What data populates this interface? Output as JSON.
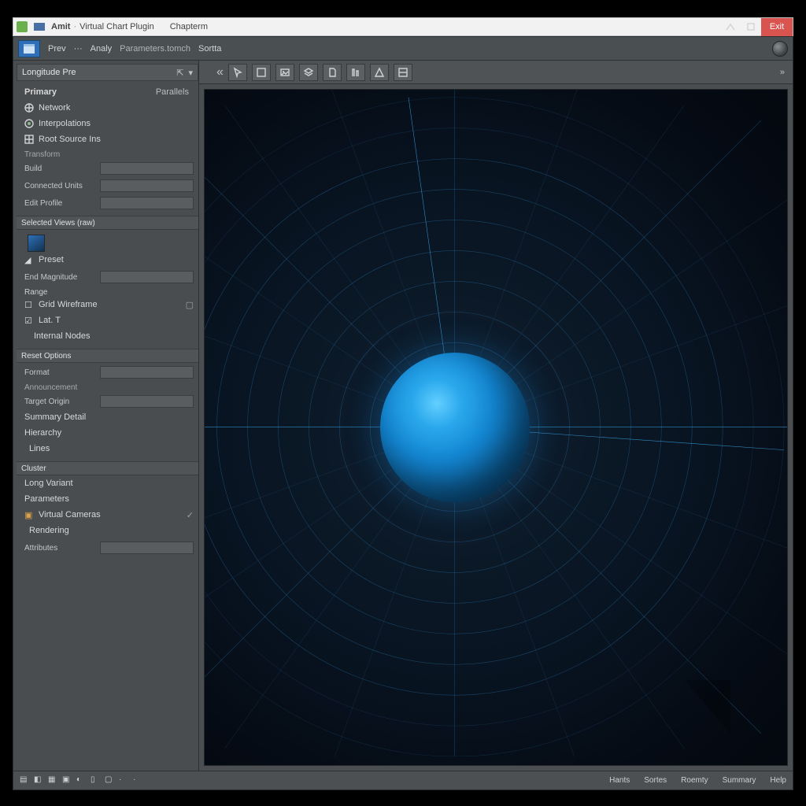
{
  "window": {
    "app_name": "Amit",
    "title_secondary": "Virtual Chart Plugin",
    "title_tertiary": "Chapterm",
    "close_label": "Exit"
  },
  "menubar": {
    "items": [
      "Prev",
      "Analy",
      "Parameters.tomch",
      "Sortta"
    ]
  },
  "sidebar": {
    "panel_title": "Longitude Pre",
    "top_tab_left": "Primary",
    "top_tab_right": "Parallels",
    "nav": [
      {
        "label": "Network",
        "icon": "globe"
      },
      {
        "label": "Interpolations",
        "icon": "target"
      },
      {
        "label": "Root Source Ins",
        "icon": "grid"
      }
    ],
    "group_transform": {
      "header": "Transform",
      "fields": [
        {
          "label": "Build",
          "value": ""
        },
        {
          "label": "Connected Units",
          "value": ""
        },
        {
          "label": "Edit Profile",
          "value": ""
        }
      ]
    },
    "group_activestring": {
      "header": "Selected Views (raw)",
      "preset_label": "Preset",
      "fields": [
        {
          "label": "End Magnitude",
          "value": ""
        },
        {
          "label": "Range",
          "value": ""
        }
      ],
      "checks": [
        {
          "label": "Grid Wireframe",
          "checked": false
        },
        {
          "label": "Lat. T",
          "checked": true
        },
        {
          "label": "Internal Nodes",
          "checked": false
        }
      ]
    },
    "group_description": {
      "header": "Reset Options",
      "fields": [
        {
          "label": "Format",
          "value": ""
        }
      ],
      "sub_header": "Announcement",
      "items": [
        "Target Origin",
        "Summary Detail",
        "Hierarchy",
        "Lines"
      ]
    },
    "group_cluster": {
      "header": "Cluster",
      "items": [
        "Long Variant",
        "Parameters"
      ],
      "checks": [
        {
          "label": "Virtual Cameras",
          "checked": true
        }
      ],
      "items2": [
        "Rendering"
      ],
      "fields": [
        {
          "label": "Attributes",
          "value": ""
        }
      ]
    }
  },
  "toolbar": {
    "buttons": [
      {
        "name": "pointer",
        "glyph": "cursor"
      },
      {
        "name": "frame",
        "glyph": "frame"
      },
      {
        "name": "image",
        "glyph": "image"
      },
      {
        "name": "layers",
        "glyph": "layers"
      },
      {
        "name": "page",
        "glyph": "page"
      },
      {
        "name": "measure",
        "glyph": "measure"
      },
      {
        "name": "perspect",
        "glyph": "persp"
      },
      {
        "name": "palette",
        "glyph": "palette"
      }
    ]
  },
  "statusbar": {
    "right": [
      "Hants",
      "Sortes",
      "Roemty",
      "Summary",
      "Help"
    ]
  },
  "colors": {
    "accent": "#2aa8ec",
    "panel": "#494d50",
    "canvas_bg": "#081320"
  }
}
